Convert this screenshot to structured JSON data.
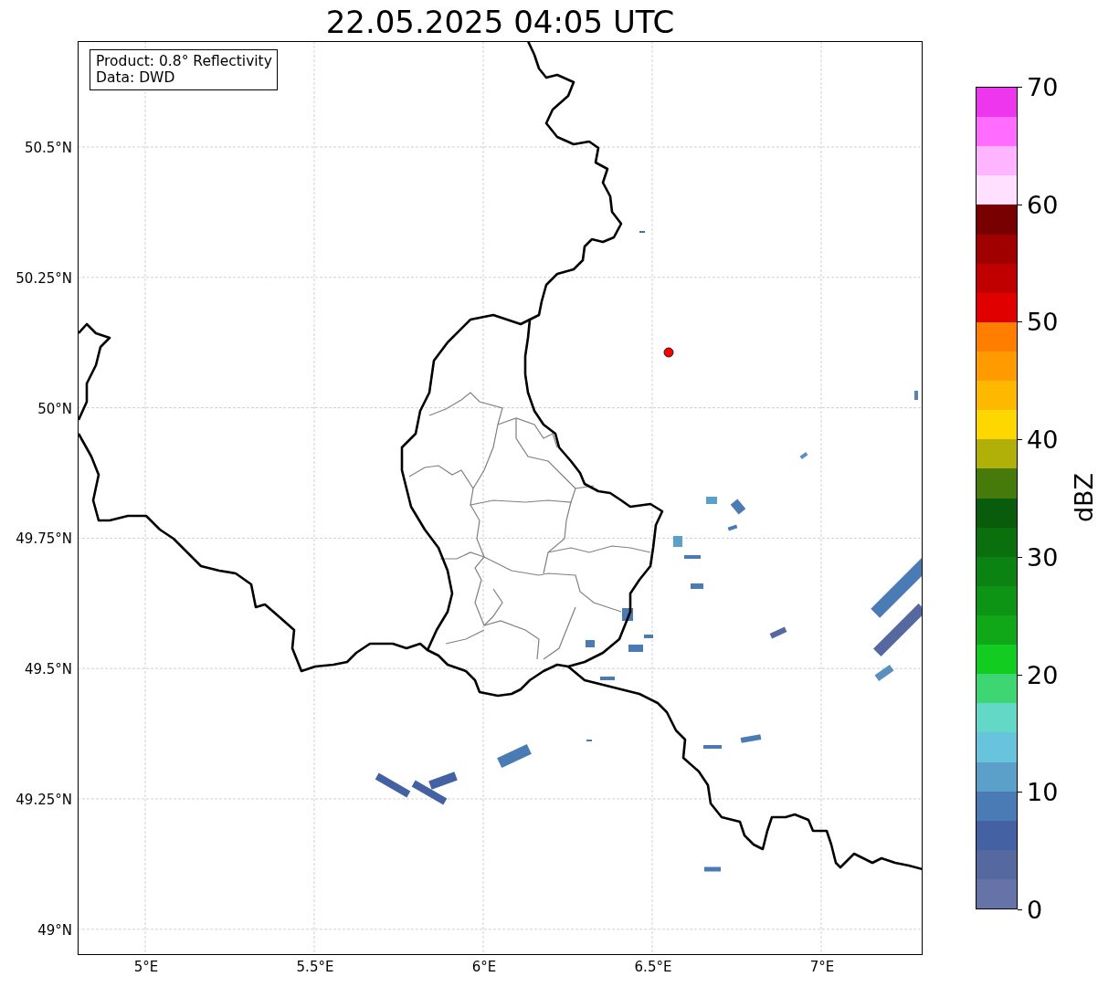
{
  "title": "22.05.2025 04:05 UTC",
  "info_box": {
    "lines": [
      "Product: 0.8° Reflectivity",
      "Data: DWD"
    ]
  },
  "map": {
    "lat_ticks": [
      "50.5°N",
      "50.25°N",
      "50°N",
      "49.75°N",
      "49.5°N",
      "49.25°N",
      "49°N"
    ],
    "lon_ticks": [
      "5°E",
      "5.5°E",
      "6°E",
      "6.5°E",
      "7°E"
    ]
  },
  "colorbar": {
    "label": "dBZ",
    "ticks": [
      "70",
      "60",
      "50",
      "40",
      "30",
      "20",
      "10",
      "0"
    ],
    "bands": [
      {
        "color": "#ee36ee"
      },
      {
        "color": "#ff6cff"
      },
      {
        "color": "#ffb4ff"
      },
      {
        "color": "#ffe0ff"
      },
      {
        "color": "#780000"
      },
      {
        "color": "#a00000"
      },
      {
        "color": "#c00000"
      },
      {
        "color": "#e00000"
      },
      {
        "color": "#ff7e00"
      },
      {
        "color": "#ff9a00"
      },
      {
        "color": "#ffb800"
      },
      {
        "color": "#ffd700"
      },
      {
        "color": "#b0b008"
      },
      {
        "color": "#467a0a"
      },
      {
        "color": "#085c0c"
      },
      {
        "color": "#0a700e"
      },
      {
        "color": "#0c8212"
      },
      {
        "color": "#0e9414"
      },
      {
        "color": "#10a818"
      },
      {
        "color": "#12cc20"
      },
      {
        "color": "#3dd672"
      },
      {
        "color": "#64d8c6"
      },
      {
        "color": "#68c3dc"
      },
      {
        "color": "#5ba0c8"
      },
      {
        "color": "#4b7bb5"
      },
      {
        "color": "#4461a4"
      },
      {
        "color": "#5668a0"
      },
      {
        "color": "#6673a8"
      }
    ]
  }
}
